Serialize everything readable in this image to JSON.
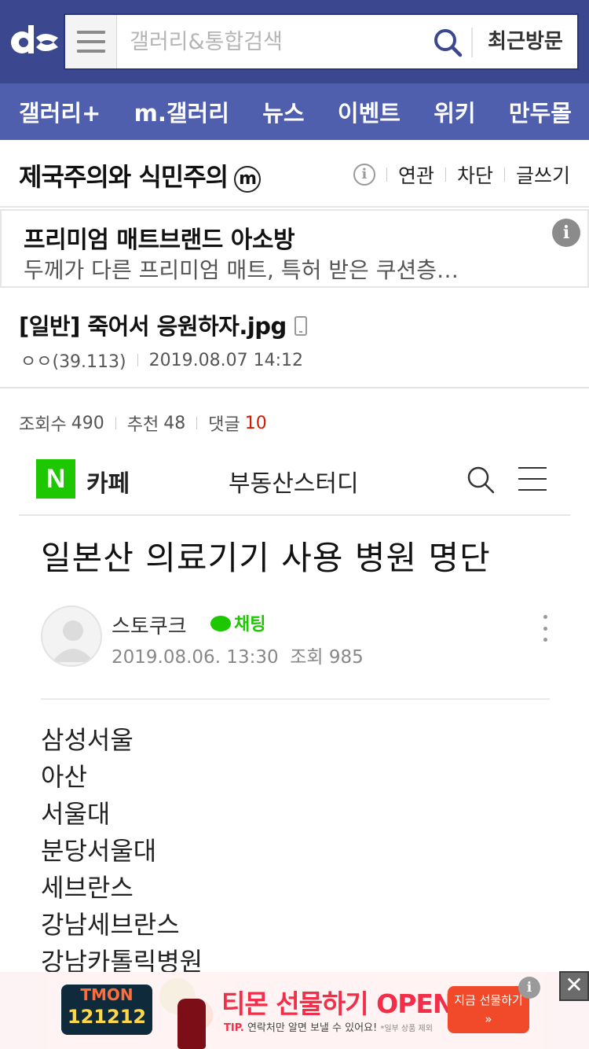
{
  "header": {
    "logo_icon": "dc-logo-icon",
    "menu_icon": "hamburger-icon",
    "search_placeholder": "갤러리&통합검색",
    "search_icon": "search-icon",
    "recent_label": "최근방문",
    "brand_color": "#3b4890"
  },
  "nav": {
    "items": [
      {
        "label": "갤러리+"
      },
      {
        "label": "m.갤러리"
      },
      {
        "label": "뉴스"
      },
      {
        "label": "이벤트"
      },
      {
        "label": "위키"
      },
      {
        "label": "만두몰"
      }
    ],
    "color": "#4f5fae"
  },
  "gallery": {
    "title": "제국주의와 식민주의",
    "badge": "m",
    "info_icon": "i",
    "links": [
      "연관",
      "차단",
      "글쓰기"
    ]
  },
  "ad": {
    "title": "프리미엄 매트브랜드 아소방",
    "description": "두께가 다른 프리미엄 매트, 특허 받은 쿠션층…",
    "info_icon": "i"
  },
  "post": {
    "title": "[일반] 죽어서 응원하자.jpg",
    "device_icon": "mobile-icon",
    "author": "ㅇㅇ(39.113)",
    "date": "2019.08.07 14:12"
  },
  "stats": {
    "views_label": "조회수",
    "views": "490",
    "recommend_label": "추천",
    "recommend": "48",
    "comments_label": "댓글",
    "comments": "10",
    "comment_color": "#d31900"
  },
  "embedded": {
    "naver_letter": "N",
    "cafe_label": "카페",
    "cafe_name": "부동산스터디",
    "article_title": "일본산 의료기기 사용 병원 명단",
    "author": "스토쿠크",
    "chat_label": "채팅",
    "date": "2019.08.06. 13:30",
    "views": "조회 985",
    "hospitals": [
      "삼성서울",
      "아산",
      "서울대",
      "분당서울대",
      "세브란스",
      "강남세브란스",
      "강남카톨릭병원"
    ]
  },
  "bottom_ad": {
    "logo_top": "TMON",
    "logo_bottom": "121212",
    "title": "티몬 선물하기 OPEN",
    "tip": "TIP.",
    "subtitle": "연락처만 알면 보낼 수 있어요!",
    "note": "*일부 상품 제외",
    "cta_line1": "지금 선물하기",
    "cta_line2": "»",
    "info_icon": "i",
    "close_icon": "✕",
    "accent_color": "#f22e48"
  }
}
